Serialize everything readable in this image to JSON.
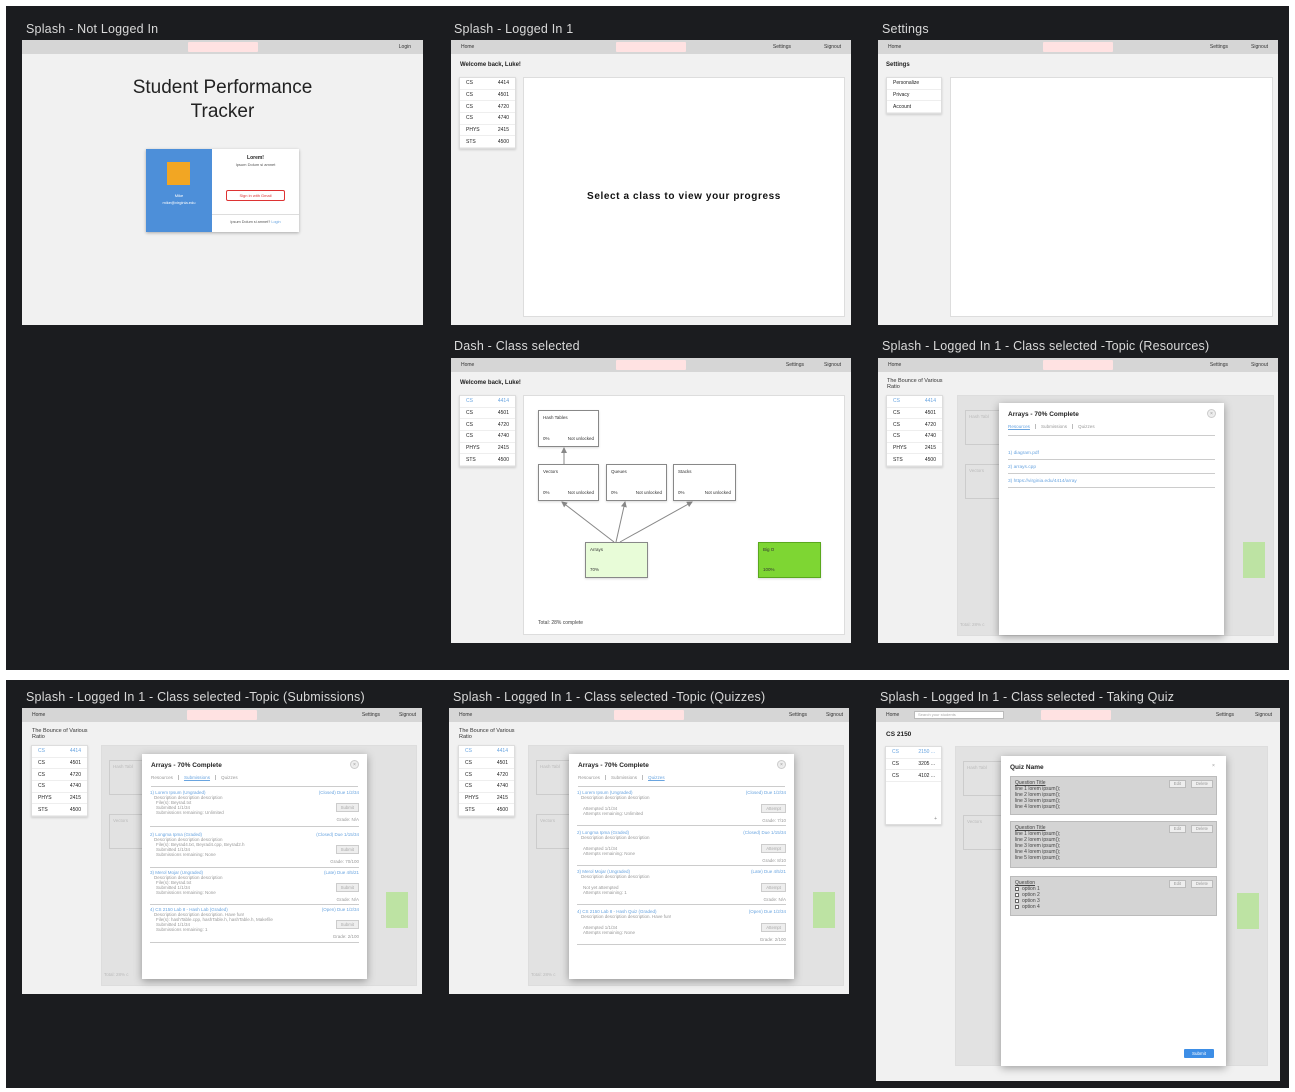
{
  "frames": {
    "f1": {
      "title": "Splash - Not Logged In",
      "topbar_right": "Login",
      "app_title_1": "Student Performance",
      "app_title_2": "Tracker",
      "card": {
        "heading": "Lorem!",
        "sub": "Ipsum Dolum si amnet",
        "name": "Mike",
        "email": "mike@virginia.edu",
        "signin": "Sign in with Gmail",
        "footer": "Ipsum Dolum si amnet?",
        "footer_link": "Login"
      }
    },
    "f2": {
      "title": "Splash - Logged In 1",
      "home": "Home",
      "settings": "Settings",
      "signout": "Signout",
      "welcome": "Welcome back, Luke!",
      "center": "Select a class to view your progress"
    },
    "f3": {
      "title": "Settings",
      "home": "Home",
      "settings": "Settings",
      "signout": "Signout",
      "heading": "Settings",
      "items": [
        "Personalize",
        "Privacy",
        "Account"
      ]
    },
    "f4": {
      "title": "Dash - Class selected",
      "home": "Home",
      "settings": "Settings",
      "signout": "Signout",
      "welcome": "Welcome back, Luke!",
      "total": "Total: 28% complete"
    },
    "f5": {
      "title": "Splash - Logged In 1 - Class selected -Topic (Resources)",
      "home": "Home",
      "settings": "Settings",
      "signout": "Signout",
      "course_1": "The Bounce of Various",
      "course_2": "Ratio",
      "total": "Total: 28% c"
    },
    "f6": {
      "title": "Splash - Logged In 1 - Class selected -Topic (Submissions)",
      "home": "Home",
      "settings": "Settings",
      "signout": "Signout",
      "course_1": "The Bounce of Various",
      "course_2": "Ratio",
      "total": "Total: 28% c"
    },
    "f7": {
      "title": "Splash - Logged In 1 - Class selected -Topic (Quizzes)",
      "home": "Home",
      "settings": "Settings",
      "signout": "Signout",
      "course_1": "The Bounce of Various",
      "course_2": "Ratio",
      "total": "Total: 28% c"
    },
    "f8": {
      "title": "Splash - Logged In 1 - Class selected - Taking Quiz",
      "home": "Home",
      "settings": "Settings",
      "signout": "Signout",
      "search_placeholder": "Search your students",
      "course": "CS 2150"
    }
  },
  "classes": [
    {
      "dept": "CS",
      "num": "4414"
    },
    {
      "dept": "CS",
      "num": "4501"
    },
    {
      "dept": "CS",
      "num": "4720"
    },
    {
      "dept": "CS",
      "num": "4740"
    },
    {
      "dept": "PHYS",
      "num": "2415"
    },
    {
      "dept": "STS",
      "num": "4500"
    }
  ],
  "quiz_classes": [
    {
      "dept": "CS",
      "num": "2150 ..."
    },
    {
      "dept": "CS",
      "num": "3205 ..."
    },
    {
      "dept": "CS",
      "num": "4102 ..."
    }
  ],
  "topics": {
    "hash": {
      "name": "Hash Tables",
      "pct": "0%",
      "status": "Not unlocked"
    },
    "vectors": {
      "name": "Vectors",
      "pct": "0%",
      "status": "Not unlocked"
    },
    "queues": {
      "name": "Queues",
      "pct": "0%",
      "status": "Not unlocked"
    },
    "stacks": {
      "name": "Stacks",
      "pct": "0%",
      "status": "Not unlocked"
    },
    "arrays": {
      "name": "Arrays",
      "pct": "70%"
    },
    "bigo": {
      "name": "Big O",
      "pct": "100%"
    },
    "faded_hash": "Hash Tabl",
    "faded_vec": "Vectors",
    "faded_pct": "0%",
    "faded_no": "No"
  },
  "modal": {
    "title": "Arrays - 70% Complete",
    "close": "×",
    "tabs": [
      "Resources",
      "Submissions",
      "Quizzes"
    ],
    "resources": [
      "1) diagram.pdf",
      "2) arrays.cpp",
      "3) https://virginia.edu/4414/array"
    ],
    "submissions": [
      {
        "name": "1) Lorem Ipsum (Ungraded)",
        "due": "(Closed) Due 1/2/34",
        "desc": "Description description description",
        "l1": "File(s): Beyrad.txt",
        "l2": "Submitted 1/1/34",
        "l3": "Submissions remaining: Unlimited",
        "btn": "Submit",
        "grade": "Grade: N/A"
      },
      {
        "name": "2) Longma Ipma (Graded)",
        "due": "(Closed) Due 1/15/34",
        "desc": "Description description description",
        "l1": "File(s): Beyrad4.txt, Beyrad4.cpp, Beyrad2.h",
        "l2": "Submitted 1/1/34",
        "l3": "Submissions remaining: None",
        "btn": "Submit",
        "grade": "Grade: 70/100"
      },
      {
        "name": "3) Merol Mojar (Ungraded)",
        "due": "(Late) Due 4/5/21",
        "desc": "Description description description",
        "l1": "File(s): Beyrad.txt",
        "l2": "Submitted 1/1/34",
        "l3": "Submissions remaining: None",
        "btn": "Submit",
        "grade": "Grade: N/A"
      },
      {
        "name": "4) CS 2150 Lab 8 - Hash Lab (Graded)",
        "due": "(Open) Due 1/2/34",
        "desc": "Description description description. Have fun!",
        "l1": "File(s): hashTable.cpp, hashTable.h, hashTable.h, Makefile",
        "l2": "Submitted 1/1/34",
        "l3": "Submissions remaining: 1",
        "btn": "Submit",
        "grade": "Grade: 2/100"
      }
    ],
    "quizzes": [
      {
        "name": "1) Lorem Ipsum (Ungraded)",
        "due": "(Closed) Due 1/2/34",
        "desc": "Description description description",
        "l1": "Attempted 1/1/34",
        "l2": "Attempts remaining: Unlimited",
        "btn": "Attempt",
        "grade": "Grade: 7/10"
      },
      {
        "name": "2) Longma Ipma (Graded)",
        "due": "(Closed) Due 1/15/34",
        "desc": "Description description description",
        "l1": "Attempted 1/1/34",
        "l2": "Attempts remaining: None",
        "btn": "Attempt",
        "grade": "Grade: 8/10"
      },
      {
        "name": "3) Merol Mojar (Ungraded)",
        "due": "(Late) Due 4/5/21",
        "desc": "Description description description",
        "l1": "Not yet attempted",
        "l2": "Attempts remaining: 1",
        "btn": "Attempt",
        "grade": "Grade: N/A"
      },
      {
        "name": "4) CS 2150 Lab 8 - Hash Quiz (Graded)",
        "due": "(Open) Due 1/2/34",
        "desc": "Description description description. Have fun!",
        "l1": "Attempted 1/1/34",
        "l2": "Attempts remaining: None",
        "btn": "Attempt",
        "grade": "Grade: 2/100"
      }
    ]
  },
  "quiz": {
    "title": "Quiz Name",
    "close": "×",
    "edit": "Edit",
    "delete": "Delete",
    "submit": "Submit",
    "q1": {
      "title": "Question Title",
      "lines": [
        "line 1 lorem ipsum();",
        "line 2 lorem ipsum();",
        "line 3 lorem ipsum();",
        "line 4 lorem ipsum();"
      ]
    },
    "q2": {
      "title": "Question Title",
      "lines": [
        "line 1 lorem ipsum();",
        "line 2 lorem ipsum();",
        "line 3 lorem ipsum();",
        "line 4 lorem ipsum();",
        "line 5 lorem ipsum();"
      ]
    },
    "q3": {
      "title": "Question",
      "options": [
        "option 1",
        "option 2",
        "option 3",
        "option 4"
      ]
    },
    "plus": "+"
  },
  "colors": {
    "accent_blue": "#6aa5e0",
    "pill_pink": "#ffe2e2",
    "arrays_green": "#e8fcd8",
    "bigo_green": "#7ed633",
    "submit_blue": "#3d8ee6"
  }
}
